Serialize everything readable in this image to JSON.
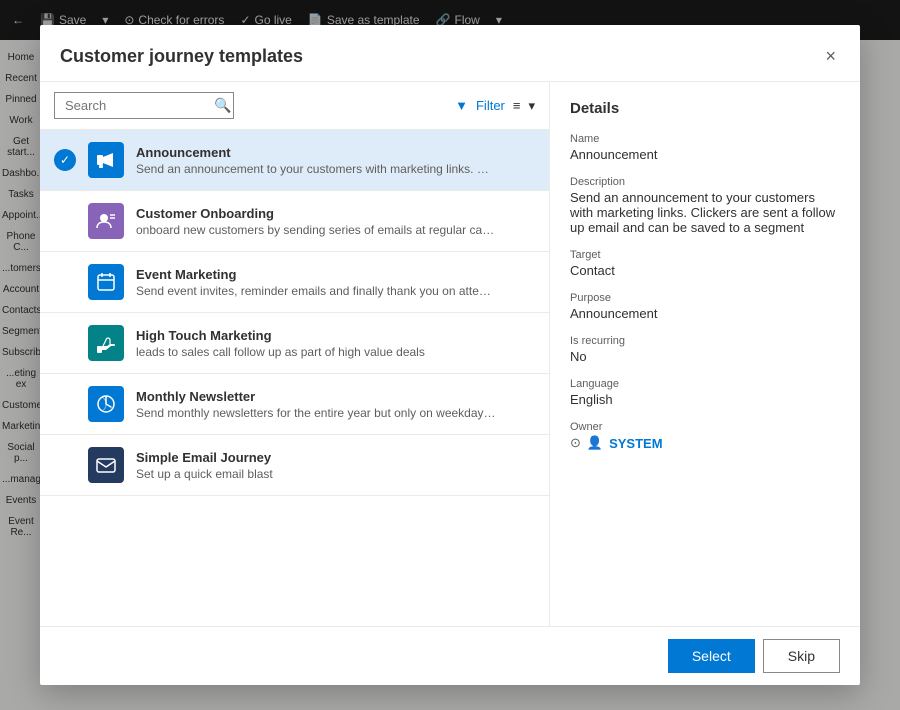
{
  "app": {
    "header": {
      "back_label": "← Back",
      "save_label": "Save",
      "check_errors_label": "Check for errors",
      "go_live_label": "Go live",
      "save_template_label": "Save as template",
      "flow_label": "Flow"
    },
    "sidebar": {
      "items": [
        "Home",
        "Recent",
        "Pinned",
        "Work",
        "Get start...",
        "Dashbo...",
        "Tasks",
        "Appoint...",
        "Phone C...",
        "...tomers",
        "Account",
        "Contacts",
        "Segment...",
        "Subscrib...",
        "...eting ex",
        "Custome...",
        "Marketin...",
        "Social p...",
        "...manag...",
        "Events",
        "Event Re..."
      ]
    }
  },
  "modal": {
    "title": "Customer journey templates",
    "close_label": "×",
    "search": {
      "placeholder": "Search",
      "value": ""
    },
    "filter_label": "Filter",
    "templates": [
      {
        "id": "announcement",
        "name": "Announcement",
        "description": "Send an announcement to your customers with marketing links. Clickers are sent a...",
        "selected": true,
        "icon_color": "#0078d4",
        "icon_char": "📢"
      },
      {
        "id": "customer-onboarding",
        "name": "Customer Onboarding",
        "description": "onboard new customers by sending series of emails at regular cadence",
        "selected": false,
        "icon_color": "#8764b8",
        "icon_char": "👤"
      },
      {
        "id": "event-marketing",
        "name": "Event Marketing",
        "description": "Send event invites, reminder emails and finally thank you on attending",
        "selected": false,
        "icon_color": "#0078d4",
        "icon_char": "📅"
      },
      {
        "id": "high-touch-marketing",
        "name": "High Touch Marketing",
        "description": "leads to sales call follow up as part of high value deals",
        "selected": false,
        "icon_color": "#038387",
        "icon_char": "📞"
      },
      {
        "id": "monthly-newsletter",
        "name": "Monthly Newsletter",
        "description": "Send monthly newsletters for the entire year but only on weekday afternoons",
        "selected": false,
        "icon_color": "#0078d4",
        "icon_char": "🔄"
      },
      {
        "id": "simple-email-journey",
        "name": "Simple Email Journey",
        "description": "Set up a quick email blast",
        "selected": false,
        "icon_color": "#243a5e",
        "icon_char": "✉"
      }
    ],
    "details": {
      "section_title": "Details",
      "name_label": "Name",
      "name_value": "Announcement",
      "description_label": "Description",
      "description_value": "Send an announcement to your customers with marketing links. Clickers are sent a follow up email and can be saved to a segment",
      "target_label": "Target",
      "target_value": "Contact",
      "purpose_label": "Purpose",
      "purpose_value": "Announcement",
      "is_recurring_label": "Is recurring",
      "is_recurring_value": "No",
      "language_label": "Language",
      "language_value": "English",
      "owner_label": "Owner",
      "owner_value": "SYSTEM"
    },
    "footer": {
      "select_label": "Select",
      "skip_label": "Skip"
    }
  }
}
